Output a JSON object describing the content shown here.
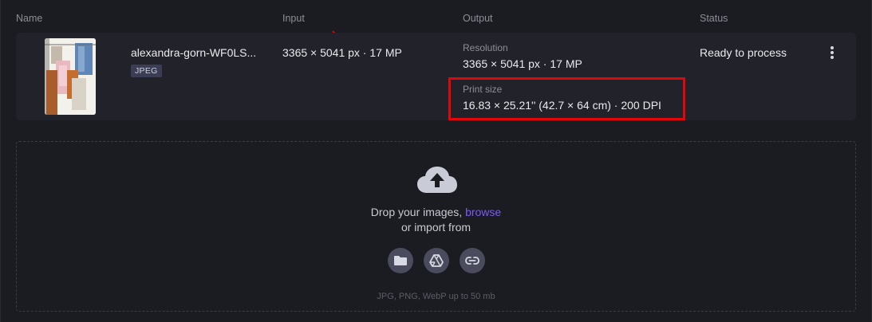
{
  "table": {
    "headers": {
      "name": "Name",
      "input": "Input",
      "output": "Output",
      "status": "Status"
    }
  },
  "file": {
    "filename": "alexandra-gorn-WF0LS...",
    "format_badge": "JPEG",
    "input_value": "3365 × 5041 px · 17 MP",
    "output": {
      "resolution_label": "Resolution",
      "resolution_value": "3365 × 5041 px · 17 MP",
      "print_size_label": "Print size",
      "print_size_value": "16.83 × 25.21'' (42.7 × 64 cm) · 200 DPI"
    },
    "status": "Ready to process"
  },
  "dropzone": {
    "prompt": "Drop your images, ",
    "browse_label": "browse",
    "import_text": "or import from",
    "sources": [
      "folder-icon",
      "google-drive-icon",
      "link-icon"
    ],
    "hint": "JPG, PNG, WebP up to 50 mb"
  },
  "colors": {
    "accent": "#7b5cf0",
    "highlight": "#e0060a",
    "background": "#1b1c21",
    "row_bg": "#22232a"
  }
}
